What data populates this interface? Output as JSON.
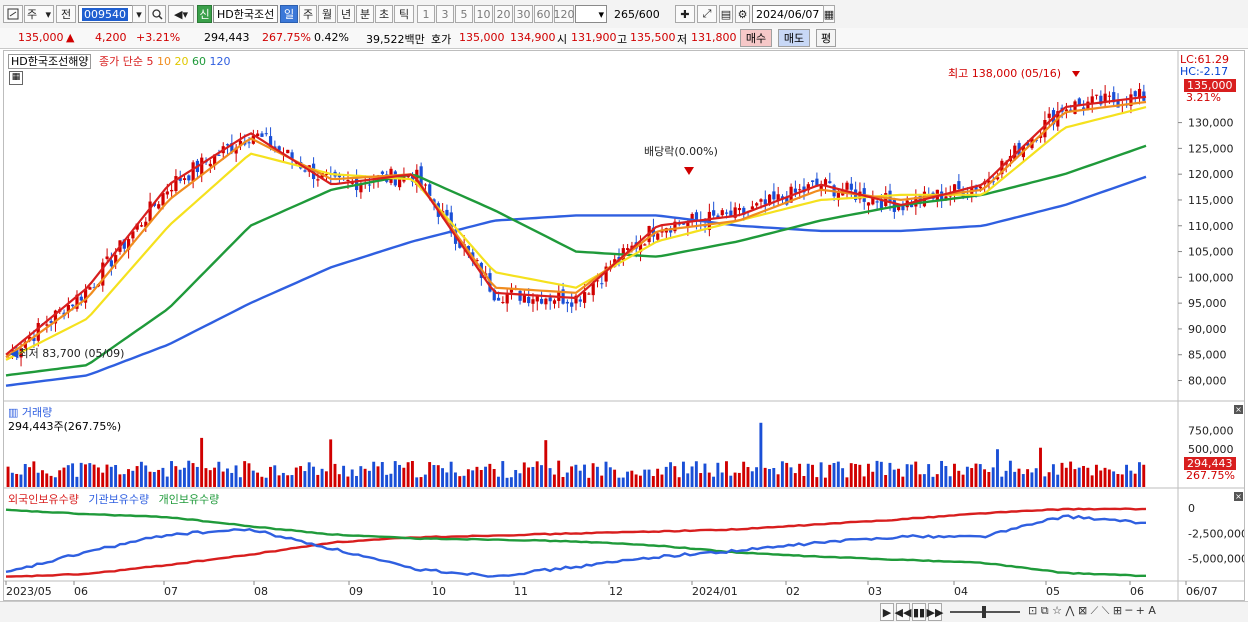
{
  "toolbar": {
    "period_main": "주",
    "prev_label": "전",
    "code": "009540",
    "name_badge": "신",
    "name": "HD한국조선",
    "periods": [
      "일",
      "주",
      "월",
      "년",
      "분",
      "초",
      "틱"
    ],
    "selected_period": "일",
    "nums": [
      "1",
      "3",
      "5",
      "10",
      "20",
      "30",
      "60",
      "120"
    ],
    "count": "265",
    "count_total": "/600",
    "date": "2024/06/07"
  },
  "quote": {
    "price": "135,000",
    "arrow": "▲",
    "change": "4,200",
    "change_pct": "+3.21%",
    "volume": "294,443",
    "vol_ratio": "267.75%",
    "turnover": "0.42%",
    "amount": "39,522백만",
    "ask_label": "호가",
    "ask": "135,000",
    "bid": "134,900",
    "open_label": "시",
    "open": "131,900",
    "high_label": "고",
    "high": "135,500",
    "low_label": "저",
    "low": "131,800",
    "buy_label": "매수",
    "sell_label": "매도",
    "eval_label": "평"
  },
  "price_panel": {
    "name_tag": "HD한국조선해양",
    "ma_title": "종가 단순",
    "ma_periods": [
      "5",
      "10",
      "20",
      "60",
      "120"
    ],
    "lc": "LC:61.29",
    "hc": "HC:-2.17",
    "current": "135,000",
    "current_pct": "3.21%",
    "high_note": "최고 138,000 (05/16)",
    "low_note": "최저 83,700 (05/09)",
    "dividend_note": "배당락(0.00%)",
    "yaxis": [
      "130,000",
      "125,000",
      "120,000",
      "115,000",
      "110,000",
      "105,000",
      "100,000",
      "95,000",
      "90,000",
      "85,000",
      "80,000"
    ]
  },
  "volume_panel": {
    "title": "거래량",
    "value": "294,443주(267.75%)",
    "yaxis": [
      "750,000",
      "500,000"
    ],
    "current": "294,443",
    "current_pct": "267.75%"
  },
  "holding_panel": {
    "legend": [
      "외국인보유수량",
      "기관보유수량",
      "개인보유수량"
    ],
    "yaxis": [
      "0",
      "-2,500,000",
      "-5,000,000"
    ]
  },
  "xaxis": [
    "2023/05",
    "06",
    "07",
    "08",
    "09",
    "10",
    "11",
    "12",
    "2024/01",
    "02",
    "03",
    "04",
    "05",
    "06",
    "06/07"
  ],
  "colors": {
    "up": "#d00000",
    "down": "#1a4fd6",
    "ma5": "#d81e1e",
    "ma10": "#f08c1e",
    "ma20": "#f5e11e",
    "ma60": "#1f9a3a",
    "ma120": "#2f5fe0"
  },
  "chart_data": {
    "type": "line",
    "title": "HD한국조선해양",
    "ylim": [
      77000,
      140000
    ],
    "x_categories": [
      "2023/05",
      "06",
      "07",
      "08",
      "09",
      "10",
      "11",
      "12",
      "2024/01",
      "02",
      "03",
      "04",
      "05",
      "06"
    ],
    "series": [
      {
        "name": "5",
        "values": [
          85000,
          98000,
          118000,
          128000,
          118000,
          120000,
          97000,
          96000,
          110000,
          112000,
          118000,
          114000,
          118000,
          133000,
          135000
        ]
      },
      {
        "name": "10",
        "values": [
          84500,
          96000,
          115000,
          127000,
          119000,
          120000,
          98000,
          97000,
          109000,
          111000,
          117000,
          115000,
          117000,
          132000,
          134000
        ]
      },
      {
        "name": "20",
        "values": [
          84000,
          92000,
          110000,
          124000,
          120000,
          119000,
          101000,
          98000,
          107000,
          111000,
          115000,
          116000,
          116000,
          129000,
          133000
        ]
      },
      {
        "name": "60",
        "values": [
          81000,
          83000,
          94000,
          110000,
          117000,
          120000,
          113000,
          105000,
          104000,
          107000,
          111000,
          114000,
          116000,
          120000,
          125500
        ]
      },
      {
        "name": "120",
        "values": [
          79000,
          81000,
          87000,
          95000,
          102000,
          107000,
          111000,
          112000,
          112000,
          110000,
          109000,
          109000,
          110000,
          114000,
          119500
        ]
      }
    ]
  }
}
